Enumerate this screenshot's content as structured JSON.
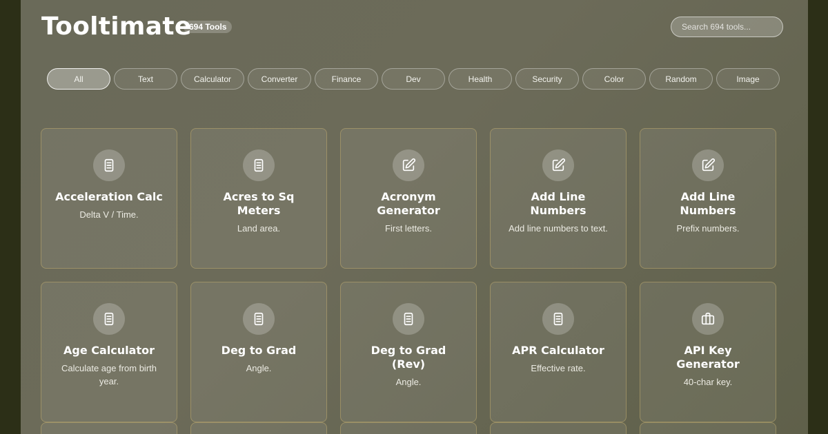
{
  "header": {
    "title": "Tooltimate",
    "tool_count_badge": "694 Tools",
    "search_placeholder": "Search 694 tools..."
  },
  "filters": [
    {
      "label": "All",
      "active": true
    },
    {
      "label": "Text",
      "active": false
    },
    {
      "label": "Calculator",
      "active": false
    },
    {
      "label": "Converter",
      "active": false
    },
    {
      "label": "Finance",
      "active": false
    },
    {
      "label": "Dev",
      "active": false
    },
    {
      "label": "Health",
      "active": false
    },
    {
      "label": "Security",
      "active": false
    },
    {
      "label": "Color",
      "active": false
    },
    {
      "label": "Random",
      "active": false
    },
    {
      "label": "Image",
      "active": false
    }
  ],
  "tools": [
    {
      "title": "Acceleration Calc",
      "desc": "Delta V / Time.",
      "icon": "document-icon"
    },
    {
      "title": "Acres to Sq Meters",
      "desc": "Land area.",
      "icon": "document-icon"
    },
    {
      "title": "Acronym Generator",
      "desc": "First letters.",
      "icon": "edit-icon"
    },
    {
      "title": "Add Line Numbers",
      "desc": "Add line numbers to text.",
      "icon": "edit-icon"
    },
    {
      "title": "Add Line Numbers",
      "desc": "Prefix numbers.",
      "icon": "edit-icon"
    },
    {
      "title": "Age Calculator",
      "desc": "Calculate age from birth year.",
      "icon": "document-icon"
    },
    {
      "title": "Deg to Grad",
      "desc": "Angle.",
      "icon": "document-icon"
    },
    {
      "title": "Deg to Grad (Rev)",
      "desc": "Angle.",
      "icon": "document-icon"
    },
    {
      "title": "APR Calculator",
      "desc": "Effective rate.",
      "icon": "document-icon"
    },
    {
      "title": "API Key Generator",
      "desc": "40-char key.",
      "icon": "briefcase-icon"
    }
  ],
  "colors": {
    "outer_background": "#2c2f17",
    "panel_background": "#6a6a59",
    "card_border": "#cdb46e"
  }
}
